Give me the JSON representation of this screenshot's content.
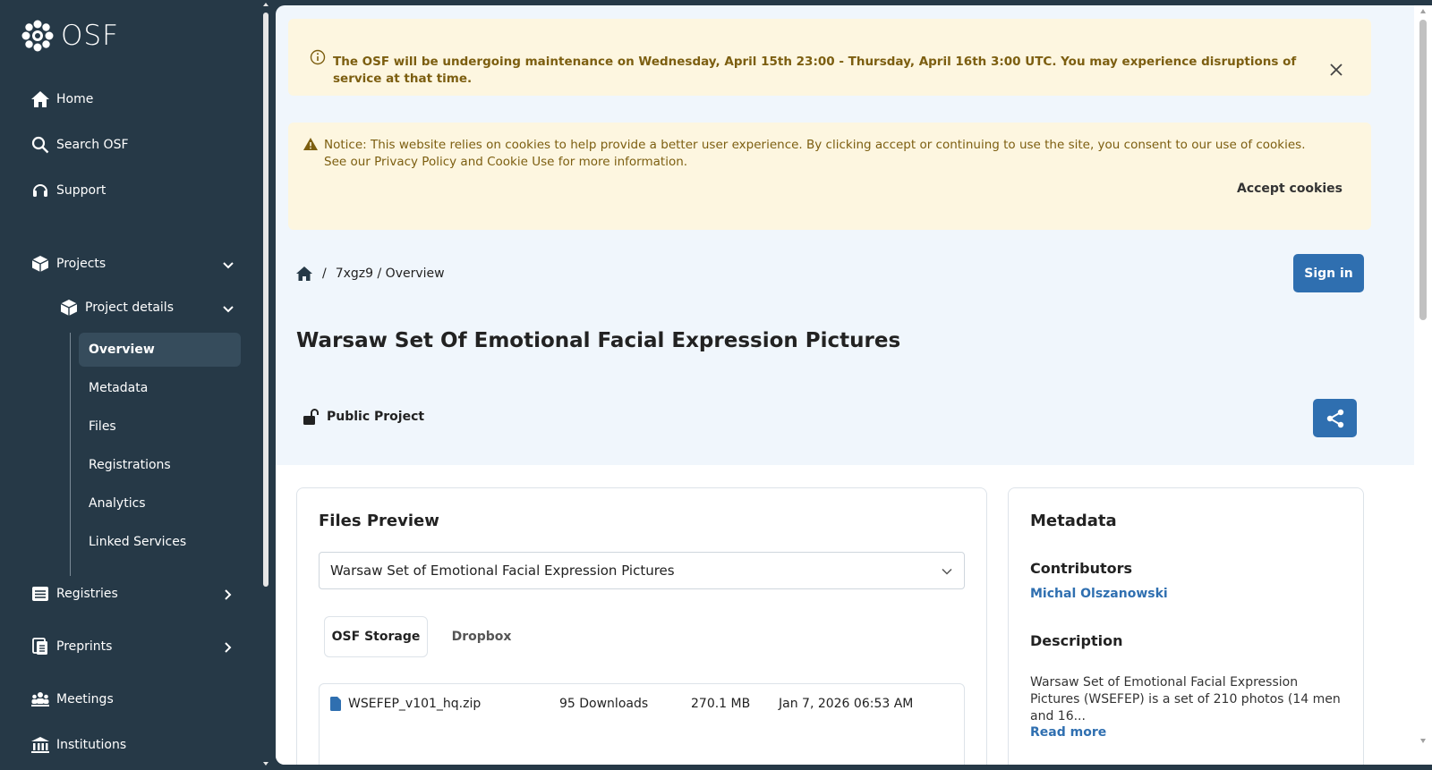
{
  "app": {
    "logo_text": "OSF"
  },
  "sidebar": {
    "nav": [
      {
        "label": "Home",
        "icon": "home-icon"
      },
      {
        "label": "Search OSF",
        "icon": "search-icon"
      },
      {
        "label": "Support",
        "icon": "headset-icon"
      },
      {
        "label": "Projects",
        "icon": "cube-icon"
      },
      {
        "label": "Registries",
        "icon": "list-icon"
      },
      {
        "label": "Preprints",
        "icon": "document-icon"
      },
      {
        "label": "Meetings",
        "icon": "people-icon"
      },
      {
        "label": "Institutions",
        "icon": "institution-icon"
      }
    ],
    "project_details": "Project details",
    "leaves": [
      "Overview",
      "Metadata",
      "Files",
      "Registrations",
      "Analytics",
      "Linked Services"
    ]
  },
  "banners": {
    "maintenance": "The OSF will be undergoing maintenance on Wednesday, April 15th 23:00 - Thursday, April 16th 3:00 UTC. You may experience disruptions of service at that time.",
    "cookies": "Notice: This website relies on cookies to help provide a better user experience. By clicking accept or continuing to use the site, you consent to our use of cookies. See our Privacy Policy and Cookie Use for more information.",
    "accept": "Accept cookies"
  },
  "breadcrumb": {
    "sep": "/",
    "path": "7xgz9 / Overview"
  },
  "header": {
    "sign_in": "Sign in",
    "title": "Warsaw Set Of Emotional Facial Expression Pictures",
    "visibility": "Public Project"
  },
  "files": {
    "heading": "Files Preview",
    "selected": "Warsaw Set of Emotional Facial Expression Pictures",
    "tabs": [
      "OSF Storage",
      "Dropbox"
    ],
    "rows": [
      {
        "name": "WSEFEP_v101_hq.zip",
        "downloads": "95 Downloads",
        "size": "270.1 MB",
        "date": "Jan 7, 2026 06:53 AM"
      }
    ]
  },
  "metadata": {
    "heading": "Metadata",
    "contributors_label": "Contributors",
    "contributor": "Michal Olszanowski",
    "description_label": "Description",
    "description": "Warsaw Set of Emotional Facial Expression Pictures (WSEFEP) is a set of 210 photos (14 men and 16...",
    "read_more": "Read more"
  },
  "colors": {
    "sidebar_bg": "#263947",
    "accent": "#2f6fb0",
    "banner_bg": "#fdf6e0"
  }
}
